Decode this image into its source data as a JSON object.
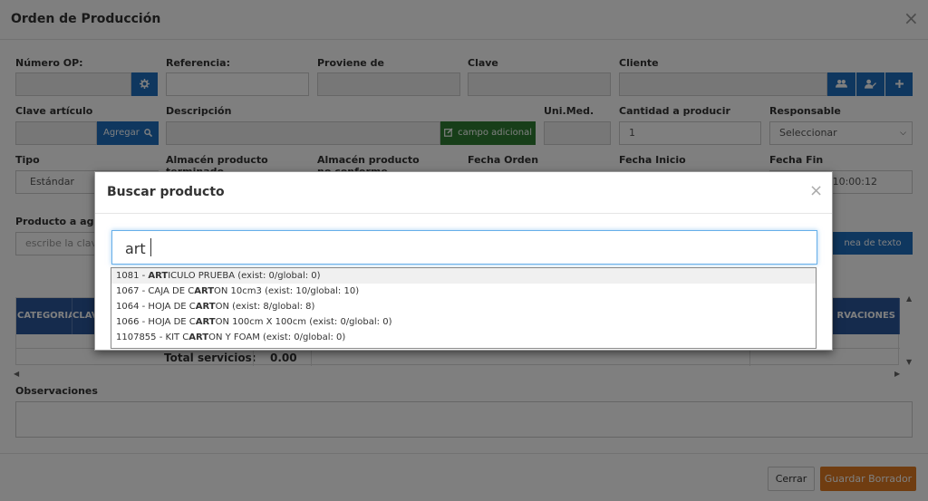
{
  "window": {
    "title": "Orden de Producción",
    "close_glyph": "×"
  },
  "fields": {
    "numero_op": {
      "label": "Número OP:"
    },
    "referencia": {
      "label": "Referencia:"
    },
    "proviene_de": {
      "label": "Proviene de"
    },
    "clave": {
      "label": "Clave"
    },
    "cliente": {
      "label": "Cliente"
    },
    "clave_articulo": {
      "label": "Clave artículo",
      "button": "Agregar"
    },
    "descripcion": {
      "label": "Descripción",
      "button": "campo adicional"
    },
    "uni_med": {
      "label": "Uni.Med."
    },
    "cantidad": {
      "label": "Cantidad a producir",
      "value": "1"
    },
    "responsable": {
      "label": "Responsable",
      "value": "Seleccionar"
    },
    "tipo": {
      "label": "Tipo",
      "value": "Estándar"
    },
    "almacen_terminado": {
      "label": "Almacén producto terminado"
    },
    "almacen_no_conforme": {
      "label": "Almacén producto no conforme"
    },
    "fecha_orden": {
      "label": "Fecha Orden"
    },
    "fecha_inicio": {
      "label": "Fecha Inicio"
    },
    "fecha_fin": {
      "label": "Fecha Fin",
      "value": "10:00:12"
    },
    "producto_agregar": {
      "label": "Producto a agre",
      "placeholder": "escribe la clave",
      "button": "nea de texto"
    }
  },
  "table": {
    "headers": [
      "CATEGORIA",
      "CLAV",
      "RVACIONES"
    ],
    "total_label": "Total servicios:",
    "total_value": "0.00"
  },
  "observaciones": {
    "label": "Observaciones"
  },
  "footer": {
    "cancel": "Cerrar",
    "save": "Guardar Borrador"
  },
  "modal": {
    "title": "Buscar producto",
    "close_glyph": "×",
    "search_value": "art",
    "results": [
      {
        "code": "1081",
        "pre": "",
        "match": "ART",
        "post": "ICULO PRUEBA",
        "stock": "(exist: 0/global: 0)"
      },
      {
        "code": "1067",
        "pre": "CAJA DE C",
        "match": "ART",
        "post": "ON 10cm3",
        "stock": "(exist: 10/global: 10)"
      },
      {
        "code": "1064",
        "pre": "HOJA DE C",
        "match": "ART",
        "post": "ON",
        "stock": "(exist: 8/global: 8)"
      },
      {
        "code": "1066",
        "pre": "HOJA DE C",
        "match": "ART",
        "post": "ON 100cm X 100cm",
        "stock": "(exist: 0/global: 0)"
      },
      {
        "code": "1107855",
        "pre": "KIT C",
        "match": "ART",
        "post": "ON Y FOAM",
        "stock": "(exist: 0/global: 0)"
      }
    ]
  },
  "colors": {
    "primary": "#1f6fbf",
    "success": "#2e7d32",
    "warning": "#e07b22",
    "table_header": "#2b579a"
  },
  "icons": {
    "settings": "gear-icon",
    "search": "search-icon",
    "users": "users-icon",
    "user_edit": "user-edit-icon",
    "add": "plus-icon",
    "edit": "edit-icon"
  }
}
